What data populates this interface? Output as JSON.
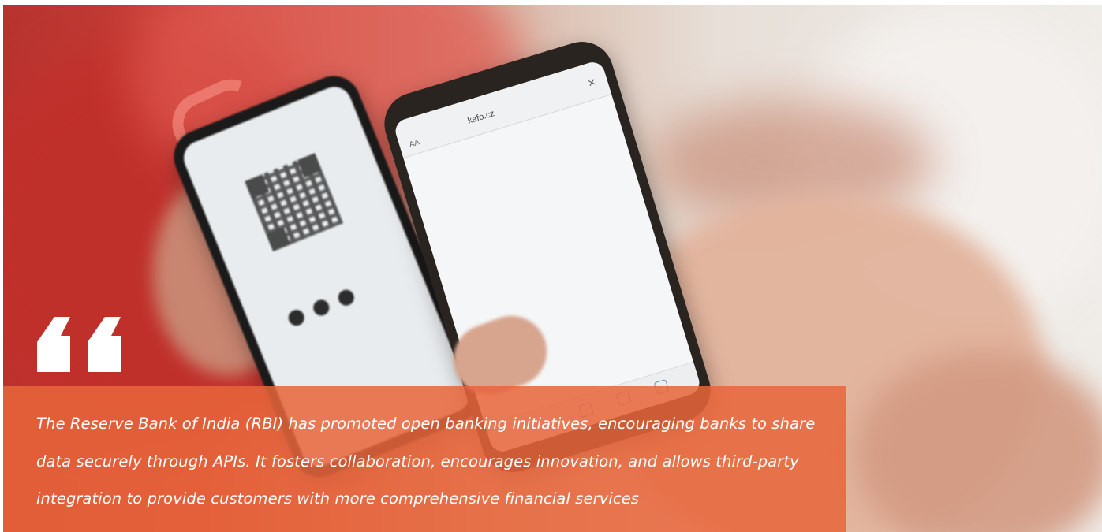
{
  "hero": {
    "image_alt": "photo-two-phones-qr-payment",
    "phone_right": {
      "url": "kafo.cz",
      "text_size_label": "AA",
      "close_symbol": "×"
    }
  },
  "quote": {
    "icon": "quote-icon",
    "text": "The Reserve Bank of India (RBI) has promoted open banking initiatives, encouraging banks to share data securely through APIs. It fosters collaboration, encourages innovation, and allows third-party integration to provide customers with more comprehensive financial services"
  },
  "colors": {
    "overlay": "#E8653A",
    "text": "#FFFFFF"
  }
}
